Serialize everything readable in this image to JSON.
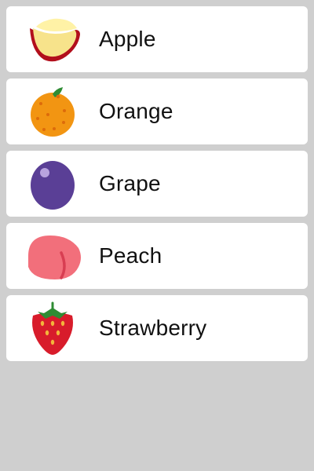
{
  "list": {
    "items": [
      {
        "label": "Apple",
        "icon": "apple-slice-icon"
      },
      {
        "label": "Orange",
        "icon": "orange-icon"
      },
      {
        "label": "Grape",
        "icon": "grape-icon"
      },
      {
        "label": "Peach",
        "icon": "peach-icon"
      },
      {
        "label": "Strawberry",
        "icon": "strawberry-icon"
      }
    ]
  },
  "colors": {
    "background": "#cfcfcf",
    "card": "#ffffff",
    "text": "#111111"
  }
}
